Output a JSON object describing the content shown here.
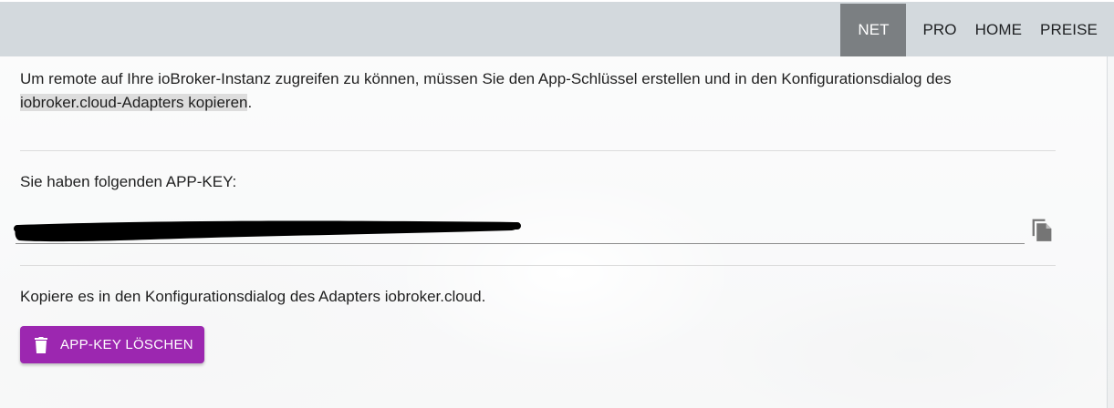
{
  "nav": {
    "items": [
      {
        "label": "NET",
        "active": true
      },
      {
        "label": "PRO",
        "active": false
      },
      {
        "label": "HOME",
        "active": false
      },
      {
        "label": "PREISE",
        "active": false
      }
    ]
  },
  "content": {
    "intro_text": "Um remote auf Ihre ioBroker-Instanz zugreifen zu können, müssen Sie den App-Schlüssel erstellen und in den Konfigurationsdialog des ",
    "intro_highlight": "iobroker.cloud-Adapters kopieren",
    "intro_end": ".",
    "key_label": "Sie haben folgenden APP-KEY:",
    "key_value": "",
    "hint": "Kopiere es in den Konfigurationsdialog des Adapters iobroker.cloud.",
    "delete_button_label": "APP-KEY LÖSCHEN"
  },
  "icons": {
    "copy": "copy-icon",
    "delete": "trash-icon"
  },
  "colors": {
    "topbar": "#d3d9dd",
    "nav_active": "#7b7f82",
    "primary_button": "#9c27b0"
  }
}
